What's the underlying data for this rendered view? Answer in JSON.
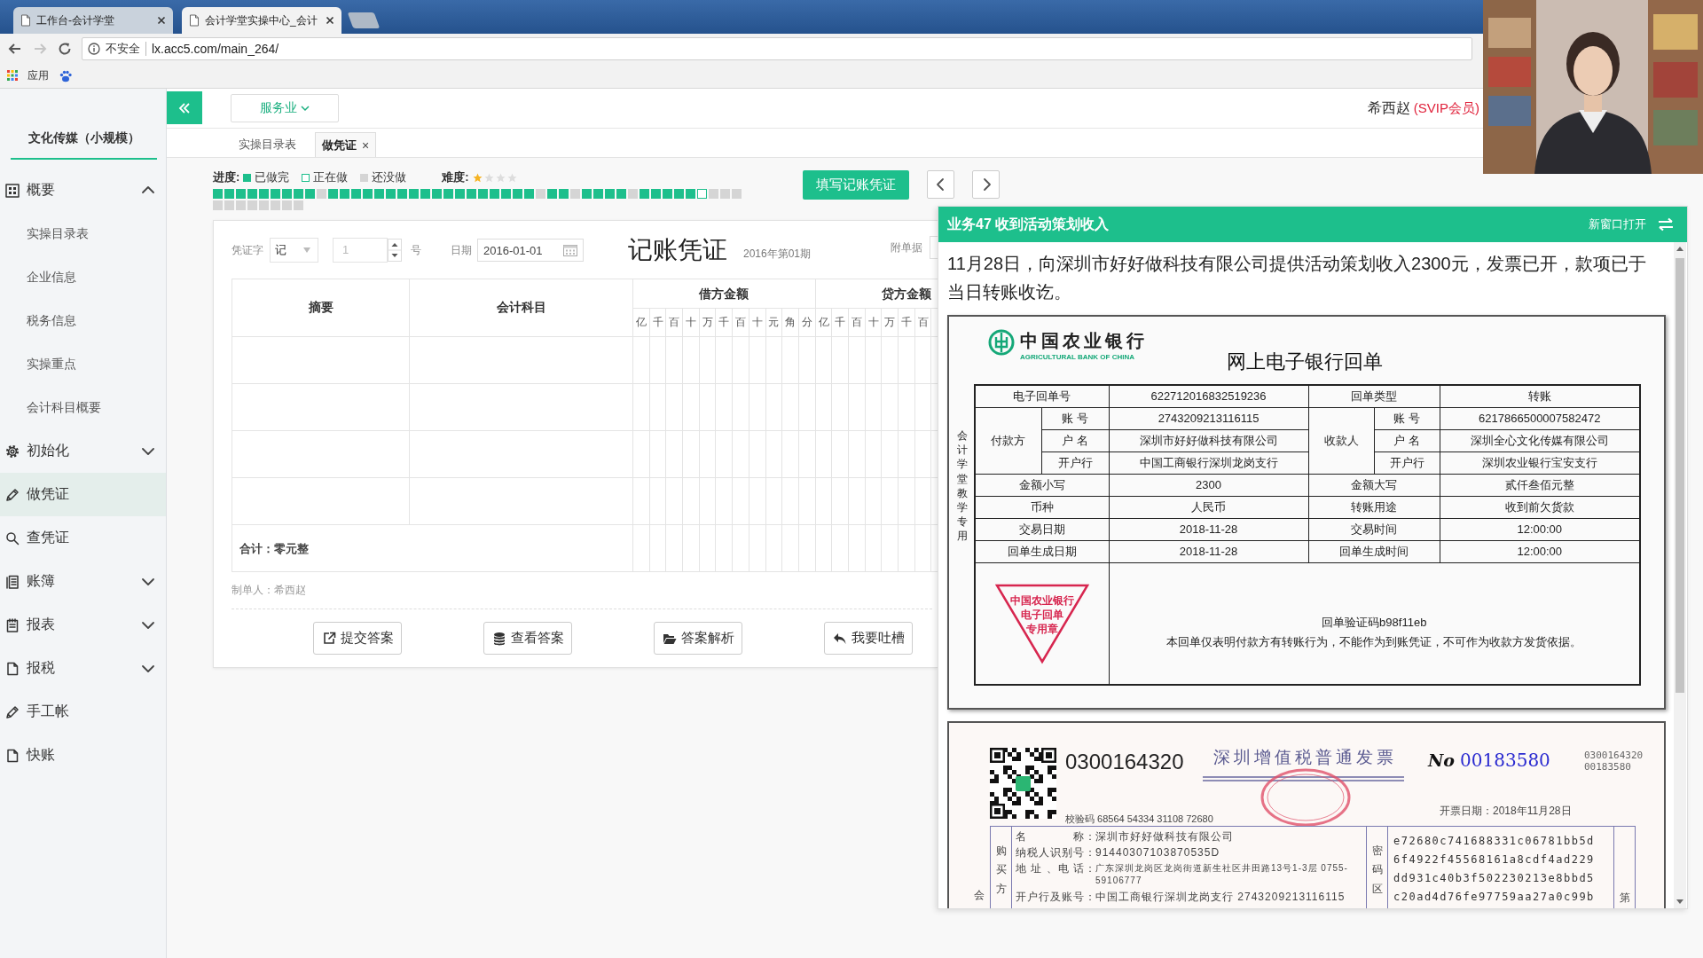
{
  "browser": {
    "tabs": [
      {
        "title": "工作台-会计学堂",
        "selected": false
      },
      {
        "title": "会计学堂实操中心_会计",
        "selected": true
      }
    ],
    "security": "不安全",
    "url": "lx.acc5.com/main_264/",
    "apps": "应用"
  },
  "header": {
    "industry": "服务业",
    "user": "希西赵",
    "badge": "(SVIP会员)"
  },
  "sidebar": {
    "company": "文化传媒（小规模）",
    "items": [
      {
        "label": "概要",
        "kind": "group",
        "expanded": true,
        "selected": false,
        "children": [
          {
            "label": "实操目录表"
          },
          {
            "label": "企业信息"
          },
          {
            "label": "税务信息"
          },
          {
            "label": "实操重点"
          },
          {
            "label": "会计科目概要"
          }
        ]
      },
      {
        "label": "初始化",
        "kind": "group",
        "expanded": false,
        "selected": false
      },
      {
        "label": "做凭证",
        "kind": "link",
        "selected": true
      },
      {
        "label": "查凭证",
        "kind": "link",
        "selected": false
      },
      {
        "label": "账簿",
        "kind": "group",
        "expanded": false,
        "selected": false
      },
      {
        "label": "报表",
        "kind": "group",
        "expanded": false,
        "selected": false
      },
      {
        "label": "报税",
        "kind": "group",
        "expanded": false,
        "selected": false
      },
      {
        "label": "手工帐",
        "kind": "link",
        "selected": false
      },
      {
        "label": "快账",
        "kind": "link",
        "selected": false
      }
    ]
  },
  "page_tabs": [
    {
      "label": "实操目录表",
      "selected": false
    },
    {
      "label": "做凭证",
      "selected": true,
      "close": "×"
    }
  ],
  "progress": {
    "label": "进度:",
    "legend": [
      {
        "label": "已做完",
        "kind": "done"
      },
      {
        "label": "正在做",
        "kind": "doing"
      },
      {
        "label": "还没做",
        "kind": "todo"
      }
    ],
    "difficulty_label": "难度:",
    "stars": 1,
    "items": [
      {
        "kind": "done"
      },
      {
        "kind": "done"
      },
      {
        "kind": "done"
      },
      {
        "kind": "done"
      },
      {
        "kind": "done"
      },
      {
        "kind": "done"
      },
      {
        "kind": "done"
      },
      {
        "kind": "done"
      },
      {
        "kind": "done"
      },
      {
        "kind": "todo"
      },
      {
        "kind": "done"
      },
      {
        "kind": "done"
      },
      {
        "kind": "done"
      },
      {
        "kind": "done"
      },
      {
        "kind": "done"
      },
      {
        "kind": "done"
      },
      {
        "kind": "done"
      },
      {
        "kind": "done"
      },
      {
        "kind": "done"
      },
      {
        "kind": "done"
      },
      {
        "kind": "done"
      },
      {
        "kind": "done"
      },
      {
        "kind": "done"
      },
      {
        "kind": "done"
      },
      {
        "kind": "done"
      },
      {
        "kind": "done"
      },
      {
        "kind": "done"
      },
      {
        "kind": "done"
      },
      {
        "kind": "todo"
      },
      {
        "kind": "done"
      },
      {
        "kind": "done"
      },
      {
        "kind": "todo"
      },
      {
        "kind": "done"
      },
      {
        "kind": "done"
      },
      {
        "kind": "done"
      },
      {
        "kind": "done"
      },
      {
        "kind": "todo"
      },
      {
        "kind": "done"
      },
      {
        "kind": "done"
      },
      {
        "kind": "done"
      },
      {
        "kind": "done"
      },
      {
        "kind": "done"
      },
      {
        "kind": "doing"
      },
      {
        "kind": "todo"
      },
      {
        "kind": "todo"
      },
      {
        "kind": "todo"
      },
      {
        "kind": "todo"
      },
      {
        "kind": "todo"
      },
      {
        "kind": "todo"
      },
      {
        "kind": "todo"
      },
      {
        "kind": "todo"
      },
      {
        "kind": "todo"
      },
      {
        "kind": "todo"
      },
      {
        "kind": "todo"
      }
    ]
  },
  "fill_button": "填写记账凭证",
  "voucher": {
    "word_label": "凭证字",
    "word": "记",
    "number": "1",
    "number_suffix": "号",
    "date_label": "日期",
    "date": "2016-01-01",
    "title": "记账凭证",
    "period": "2016年第01期",
    "attachments_label": "附单据",
    "columns": {
      "summary": "摘要",
      "account": "会计科目",
      "debit": "借方金额",
      "credit": "贷方金额",
      "debit_digits": [
        "亿",
        "千",
        "百",
        "十",
        "万",
        "千",
        "百",
        "十",
        "元",
        "角",
        "分"
      ],
      "credit_digits": [
        "亿",
        "千",
        "百",
        "十",
        "万",
        "千",
        "百"
      ]
    },
    "total": "合计：零元整",
    "preparer": "制单人：希西赵",
    "buttons": [
      {
        "label": "提交答案"
      },
      {
        "label": "查看答案"
      },
      {
        "label": "答案解析"
      },
      {
        "label": "我要吐槽"
      }
    ]
  },
  "task_panel": {
    "title": "业务47 收到活动策划收入",
    "open_new": "新窗口打开",
    "description": "11月28日，向深圳市好好做科技有限公司提供活动策划收入2300元，发票已开，款项已于当日转账收讫。",
    "receipt": {
      "bank_name": "中国农业银行",
      "bank_name_en": "AGRICULTURAL BANK OF CHINA",
      "title": "网上电子银行回单",
      "side_note": "会计学堂教学专用",
      "receipt_no": {
        "label": "电子回单号",
        "value": "622712016832519236"
      },
      "receipt_type": {
        "label": "回单类型",
        "value": "转账"
      },
      "payer": {
        "label": "付款方",
        "fields": [
          {
            "label": "账 号",
            "value": "2743209213116115"
          },
          {
            "label": "户 名",
            "value": "深圳市好好做科技有限公司"
          },
          {
            "label": "开户行",
            "value": "中国工商银行深圳龙岗支行"
          }
        ]
      },
      "payee": {
        "label": "收款人",
        "fields": [
          {
            "label": "账 号",
            "value": "6217866500007582472"
          },
          {
            "label": "户 名",
            "value": "深圳全心文化传媒有限公司"
          },
          {
            "label": "开户行",
            "value": "深圳农业银行宝安支行"
          }
        ]
      },
      "details": [
        {
          "left": {
            "label": "金额小写",
            "value": "2300"
          },
          "right": {
            "label": "金额大写",
            "value": "贰仟叁佰元整"
          }
        },
        {
          "left": {
            "label": "币种",
            "value": "人民币"
          },
          "right": {
            "label": "转账用途",
            "value": "收到前欠货款"
          }
        },
        {
          "left": {
            "label": "交易日期",
            "value": "2018-11-28"
          },
          "right": {
            "label": "交易时间",
            "value": "12:00:00"
          }
        },
        {
          "left": {
            "label": "回单生成日期",
            "value": "2018-11-28"
          },
          "right": {
            "label": "回单生成时间",
            "value": "12:00:00"
          }
        }
      ],
      "stamp_lines": [
        "中国农业银行",
        "电子回单",
        "专用章"
      ],
      "verify_code": "回单验证码b98f11eb",
      "notice": "本回单仅表明付款方有转账行为，不能作为到账凭证，不可作为收款方发货依据。"
    },
    "invoice": {
      "code": "0300164320",
      "title": "深圳增值税普通发票",
      "no_mark": "No",
      "number": "00183580",
      "code_small": "0300164320",
      "number_small": "00183580",
      "date": "开票日期：2018年11月28日",
      "check_code": "校验码 68564 54334 31108 72680",
      "buyer_label": "购买方",
      "buyer_fields": [
        {
          "label": "名　　　　称：",
          "value": "深圳市好好做科技有限公司"
        },
        {
          "label": "纳税人识别号：",
          "value": "91440307103870535D"
        },
        {
          "label": "地 址 、电 话：",
          "value": "广东深圳龙岗区龙岗街道新生社区井田路13号1-3层 0755-59106777"
        },
        {
          "label": "开户行及账号：",
          "value": "中国工商银行深圳龙岗支行 2743209213116115"
        }
      ],
      "cipher_label": "密码区",
      "cipher": [
        "e72680c741688331c06781bb5d",
        "6f4922f45568161a8cdf4ad229",
        "dd931c40b3f502230213e8bbd5",
        "c20ad4d76fe97759aa27a0c99b"
      ],
      "side_left": "会",
      "side_right": "第"
    }
  }
}
